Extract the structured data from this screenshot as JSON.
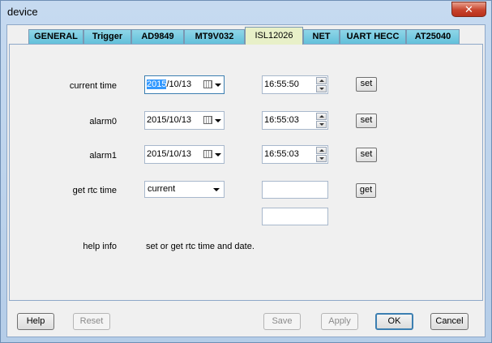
{
  "window": {
    "title": "device",
    "close_glyph": "✕"
  },
  "tabs": [
    "GENERAL",
    "Trigger",
    "AD9849",
    "MT9V032",
    "ISL12026",
    "NET",
    "UART HECC",
    "AT25040"
  ],
  "active_tab": "ISL12026",
  "rows": {
    "current_time": {
      "label": "current time",
      "date_selected_part": "2015",
      "date_rest": "/10/13",
      "time": "16:55:50",
      "button": "set"
    },
    "alarm0": {
      "label": "alarm0",
      "date": "2015/10/13",
      "time": "16:55:03",
      "button": "set"
    },
    "alarm1": {
      "label": "alarm1",
      "date": "2015/10/13",
      "time": "16:55:03",
      "button": "set"
    },
    "get_rtc": {
      "label": "get rtc time",
      "selected": "current",
      "time_value": "",
      "extra_value": "",
      "button": "get"
    }
  },
  "help": {
    "label": "help info",
    "text": "set or get rtc time and date."
  },
  "footer": {
    "help": "Help",
    "reset": "Reset",
    "save": "Save",
    "apply": "Apply",
    "ok": "OK",
    "cancel": "Cancel"
  },
  "icons": {
    "calendar": "calendar-icon",
    "dropdown": "chevron-down-icon",
    "spin_up": "spin-up-icon",
    "spin_down": "spin-down-icon"
  }
}
